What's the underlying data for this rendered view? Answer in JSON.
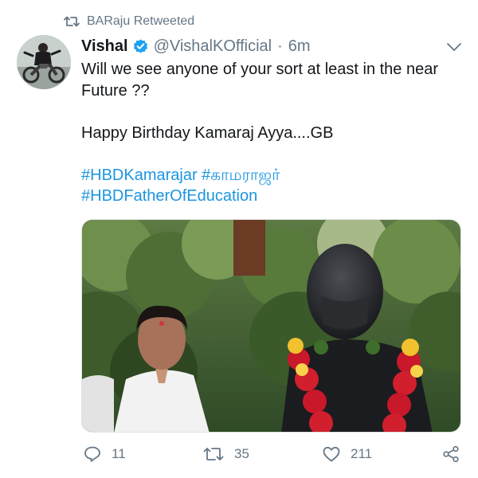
{
  "retweet": {
    "label": "BARaju Retweeted",
    "icon": "retweet-icon"
  },
  "author": {
    "name": "Vishal",
    "verified": true,
    "handle": "@VishalKOfficial",
    "separator": "·",
    "time": "6m"
  },
  "tweet": {
    "line1": "Will we see anyone of your sort at least in the near",
    "line2": "Future ??",
    "line3": "Happy Birthday Kamaraj Ayya....GB",
    "hashtag1": "#HBDKamarajar",
    "hashtag2": "#காமராஜர்",
    "hashtag3": "#HBDFatherOfEducation"
  },
  "actions": {
    "reply_count": "11",
    "retweet_count": "35",
    "like_count": "211"
  },
  "colors": {
    "link": "#1b95e0",
    "secondary": "#657786",
    "text": "#14171a",
    "verified": "#1da1f2"
  }
}
